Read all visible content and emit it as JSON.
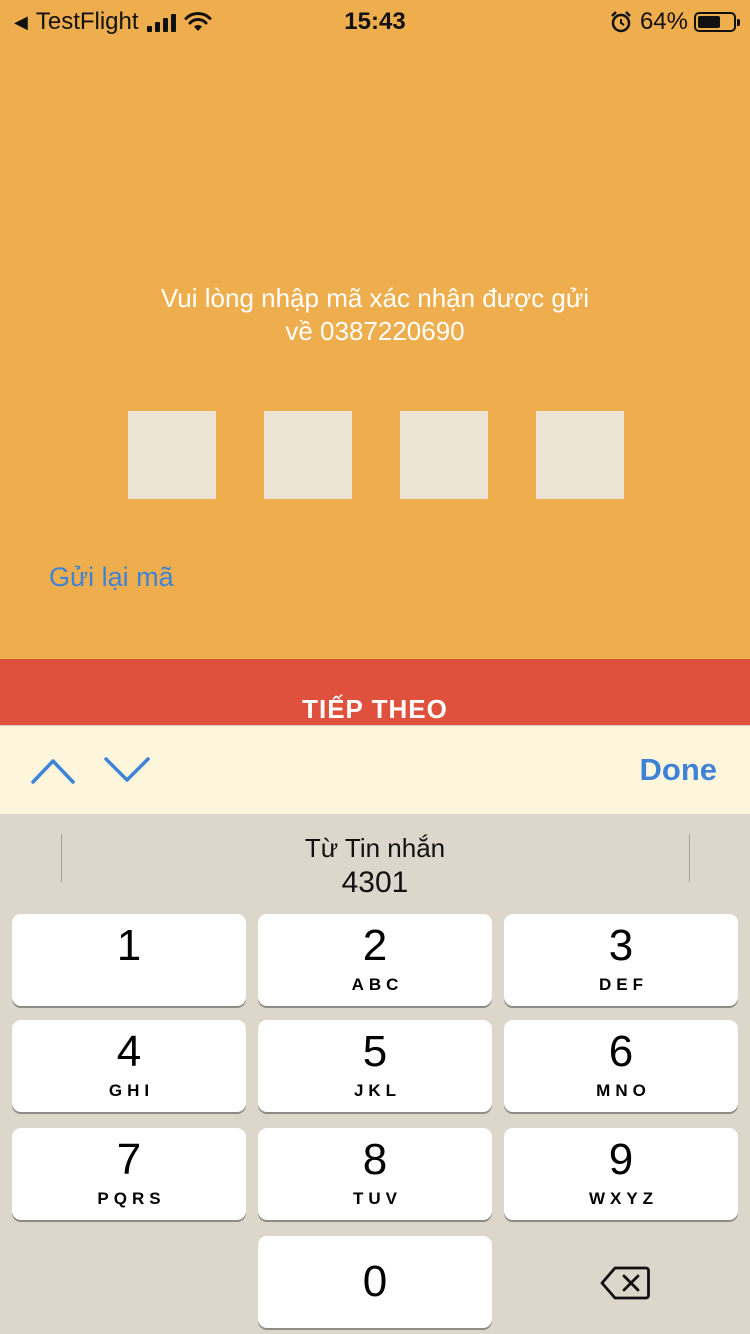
{
  "status_bar": {
    "back_app": "TestFlight",
    "time": "15:43",
    "battery": "64%",
    "battery_level": 0.64
  },
  "prompt": {
    "line1": "Vui lòng nhập mã xác nhận được gửi",
    "line2": "về 0387220690"
  },
  "code_box_count": 4,
  "resend_label": "Gửi lại mã",
  "next_label": "TIẾP THEO",
  "toolbar": {
    "done_label": "Done",
    "prev_icon": "chevron-up-icon",
    "next_icon": "chevron-down-icon"
  },
  "keyboard": {
    "suggestion_title": "Từ Tin nhắn",
    "suggestion_code": "4301",
    "keys": [
      {
        "num": "1",
        "letters": ""
      },
      {
        "num": "2",
        "letters": "ABC"
      },
      {
        "num": "3",
        "letters": "DEF"
      },
      {
        "num": "4",
        "letters": "GHI"
      },
      {
        "num": "5",
        "letters": "JKL"
      },
      {
        "num": "6",
        "letters": "MNO"
      },
      {
        "num": "7",
        "letters": "PQRS"
      },
      {
        "num": "8",
        "letters": "TUV"
      },
      {
        "num": "9",
        "letters": "WXYZ"
      },
      {
        "num": "0",
        "letters": ""
      }
    ],
    "backspace_icon": "backspace-icon"
  },
  "colors": {
    "background": "#efae4e",
    "code_box": "#ebe4d4",
    "accent_blue": "#3f83d6",
    "next_button": "#e0513d",
    "toolbar": "#fdf6dd",
    "keyboard": "#ddd6cb"
  }
}
